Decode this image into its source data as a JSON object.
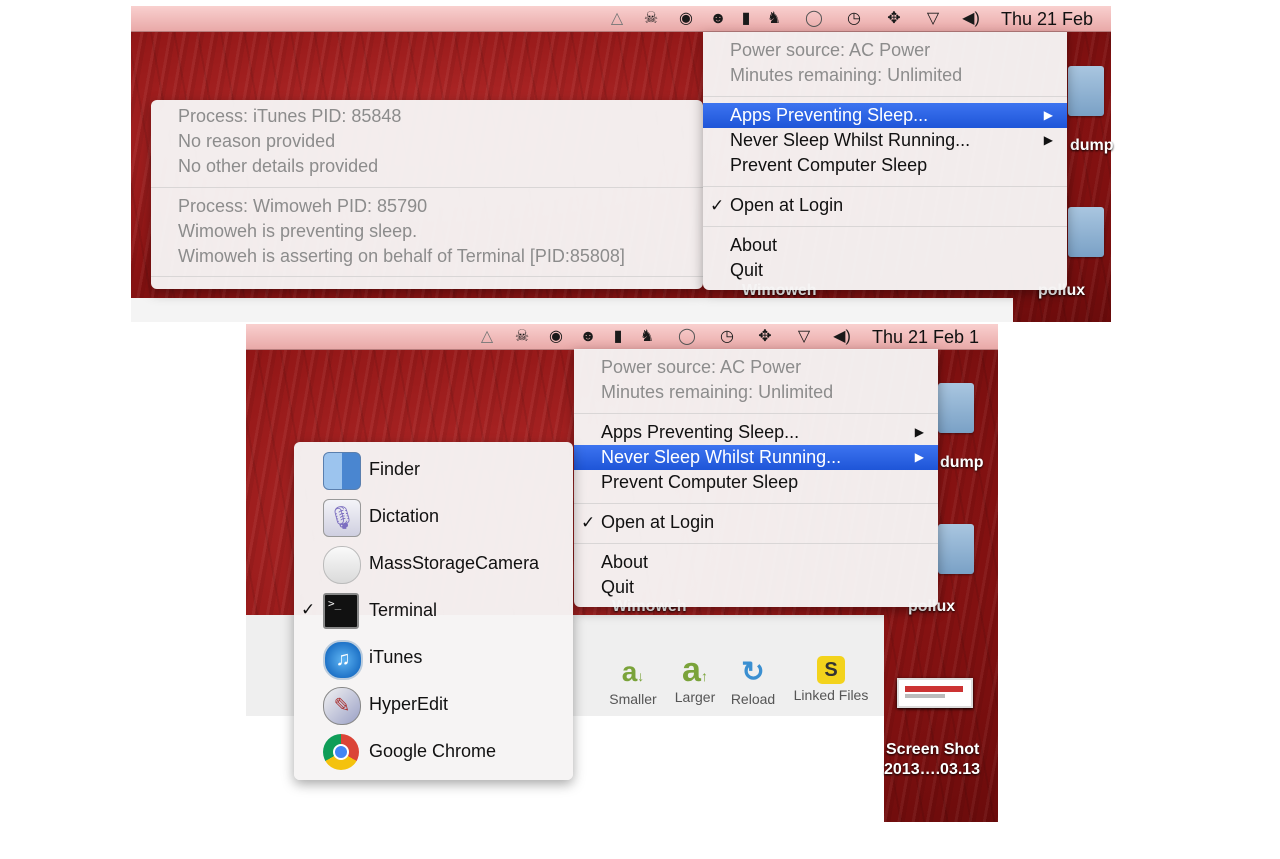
{
  "colors": {
    "highlight": "#2a62e4",
    "desktop": "#8e1414",
    "menubar": "#f2bcbb"
  },
  "menubar": {
    "icons": [
      "google-drive-icon",
      "skull-icon",
      "target-icon",
      "lion-icon",
      "bookmark-icon",
      "evernote-icon",
      "chat-bubble-icon",
      "time-machine-icon",
      "move-icon",
      "wifi-icon",
      "volume-icon"
    ],
    "clock_top": "Thu 21 Feb",
    "clock_bottom": "Thu 21 Feb  1"
  },
  "menu": {
    "power_source": "Power source: AC Power",
    "minutes_remaining": "Minutes remaining: Unlimited",
    "apps_preventing": "Apps Preventing Sleep...",
    "never_sleep": "Never Sleep Whilst Running...",
    "prevent_sleep": "Prevent Computer Sleep",
    "open_at_login": "Open at Login",
    "about": "About",
    "quit": "Quit",
    "check": "✓",
    "arrow": "▶"
  },
  "assertions": {
    "p1_process": "Process: iTunes PID: 85848",
    "p1_reason": "No reason provided",
    "p1_details": "No other details provided",
    "p2_process": "Process: Wimoweh PID: 85790",
    "p2_reason": "Wimoweh is preventing sleep.",
    "p2_details": "Wimoweh is asserting on behalf of Terminal [PID:85808]"
  },
  "apps": [
    {
      "label": "Finder",
      "checked": false
    },
    {
      "label": "Dictation",
      "checked": false
    },
    {
      "label": "MassStorageCamera",
      "checked": false
    },
    {
      "label": "Terminal",
      "checked": true
    },
    {
      "label": "iTunes",
      "checked": false
    },
    {
      "label": "HyperEdit",
      "checked": false
    },
    {
      "label": "Google Chrome",
      "checked": false
    }
  ],
  "desktop": {
    "dump": "dump",
    "pollux": "pollux",
    "wimoweh": "Wimoweh",
    "screenshot_line1": "Screen Shot",
    "screenshot_line2": "2013….03.13"
  },
  "toolbar": {
    "smaller": "Smaller",
    "larger": "Larger",
    "reload": "Reload",
    "linked_files": "Linked Files"
  }
}
